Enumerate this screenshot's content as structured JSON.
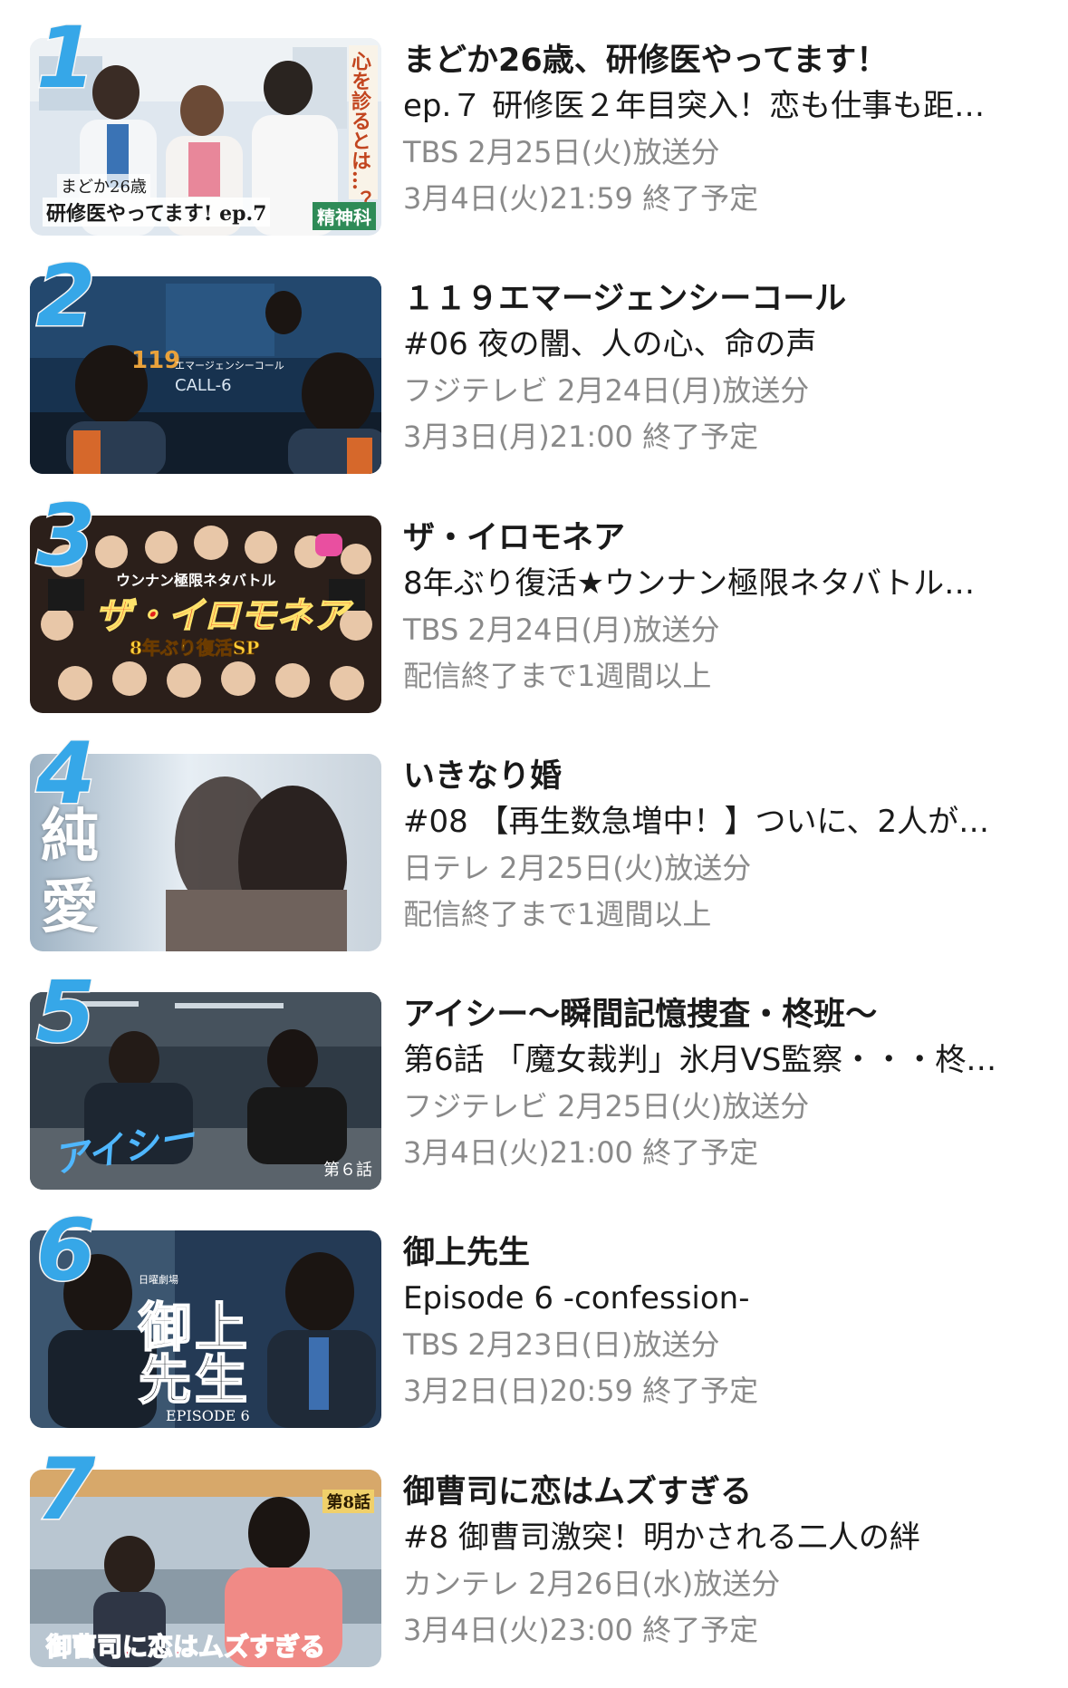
{
  "ranking": [
    {
      "rank": "1",
      "title": "まどか26歳、研修医やってます！",
      "episode": "ep.７ 研修医２年目突入！恋も仕事も距…",
      "broadcast": "TBS 2月25日(火)放送分",
      "availability": "3月4日(火)21:59 終了予定",
      "thumb_text": [
        "心を診るとは…？",
        "まどか26歳",
        "研修医やってます! ep.7",
        "精神科"
      ]
    },
    {
      "rank": "2",
      "title": "１１９エマージェンシーコール",
      "episode": "#06 夜の闇、人の心、命の声",
      "broadcast": "フジテレビ 2月24日(月)放送分",
      "availability": "3月3日(月)21:00 終了予定",
      "thumb_text": [
        "119",
        "エマージェンシーコール",
        "CALL-6"
      ]
    },
    {
      "rank": "3",
      "title": "ザ・イロモネア",
      "episode": "8年ぶり復活★ウンナン極限ネタバトル…",
      "broadcast": "TBS 2月24日(月)放送分",
      "availability": "配信終了まで1週間以上",
      "thumb_text": [
        "ウンナン極限ネタバトル",
        "ザ・イロモネア",
        "8年ぶり復活SP"
      ]
    },
    {
      "rank": "4",
      "title": "いきなり婚",
      "episode": "#08 【再生数急増中！】ついに、2人が…",
      "broadcast": "日テレ 2月25日(火)放送分",
      "availability": "配信終了まで1週間以上",
      "thumb_text": [
        "純",
        "愛"
      ]
    },
    {
      "rank": "5",
      "title": "アイシー〜瞬間記憶捜査・柊班〜",
      "episode": "第6話 「魔女裁判」氷月VS監察・・・柊…",
      "broadcast": "フジテレビ 2月25日(火)放送分",
      "availability": "3月4日(火)21:00 終了予定",
      "thumb_text": [
        "アイシー",
        "第６話"
      ]
    },
    {
      "rank": "6",
      "title": "御上先生",
      "episode": "Episode 6 -confession-",
      "broadcast": "TBS 2月23日(日)放送分",
      "availability": "3月2日(日)20:59 終了予定",
      "thumb_text": [
        "日曜劇場",
        "御上",
        "先生",
        "EPISODE 6"
      ]
    },
    {
      "rank": "7",
      "title": "御曹司に恋はムズすぎる",
      "episode": "#8 御曹司激突！明かされる二人の絆",
      "broadcast": "カンテレ 2月26日(水)放送分",
      "availability": "3月4日(火)23:00 終了予定",
      "thumb_text": [
        "第8話",
        "御曹司に恋はムズすぎる"
      ]
    }
  ],
  "colors": {
    "rank_number": "#36a7e8",
    "title_text": "#1a1a1a",
    "meta_text": "#8a8a8a",
    "background": "#ffffff"
  }
}
